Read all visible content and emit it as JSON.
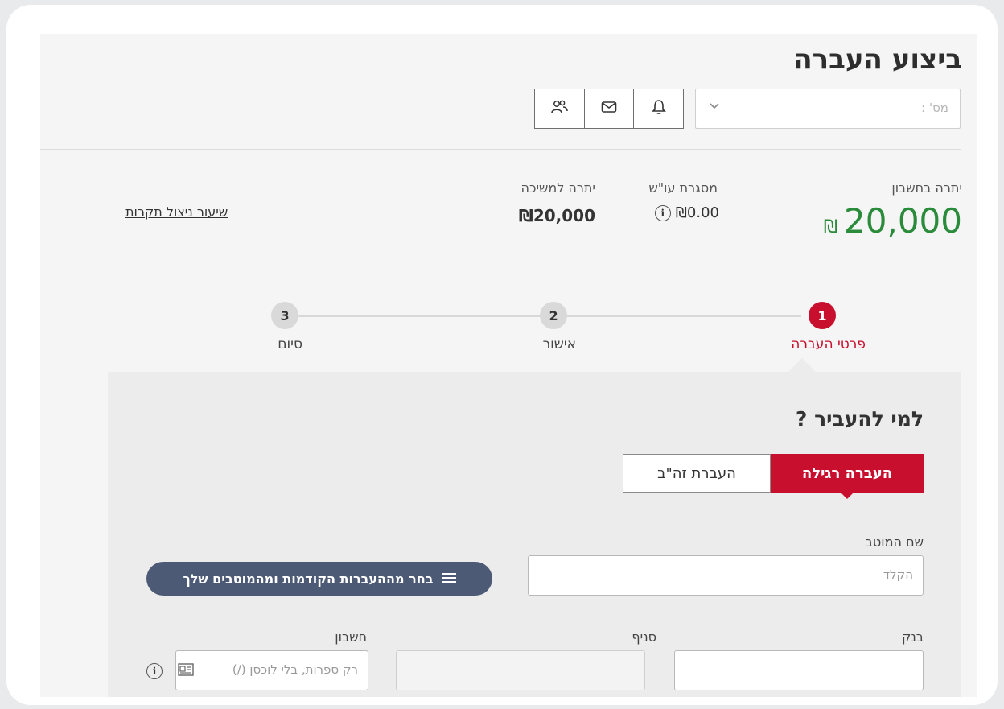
{
  "header": {
    "title": "ביצוע העברה",
    "account_select_placeholder": "מס' :"
  },
  "icons": [
    "bell-icon",
    "mail-icon",
    "people-icon",
    "chevron-down-icon",
    "info-icon",
    "list-icon",
    "id-card-icon"
  ],
  "balances": {
    "account_balance_label": "יתרה בחשבון",
    "account_balance_value": "20,000",
    "account_balance_currency": "₪",
    "overdraft_label": "מסגרת עו\"ש",
    "overdraft_value": "₪0.00",
    "withdraw_label": "יתרה למשיכה",
    "withdraw_value": "₪20,000",
    "credit_utilization_link": "שיעור ניצול תקרות"
  },
  "steps": [
    {
      "number": "1",
      "label": "פרטי העברה",
      "active": true
    },
    {
      "number": "2",
      "label": "אישור",
      "active": false
    },
    {
      "number": "3",
      "label": "סיום",
      "active": false
    }
  ],
  "form": {
    "section_title": "למי להעביר ?",
    "tabs": [
      {
        "label": "העברה רגילה",
        "selected": true
      },
      {
        "label": "העברת זה\"ב",
        "selected": false
      }
    ],
    "beneficiary_label": "שם המוטב",
    "beneficiary_placeholder": "הקלד",
    "choose_previous_button": "בחר מההעברות הקודמות ומהמוטבים שלך",
    "bank_label": "בנק",
    "branch_label": "סניף",
    "account_label": "חשבון",
    "account_placeholder": "רק ספרות, בלי לוכסן (/)"
  },
  "colors": {
    "accent": "#c8102e",
    "balance_green": "#2a8b3a",
    "pill_bg": "#4d5a75"
  }
}
